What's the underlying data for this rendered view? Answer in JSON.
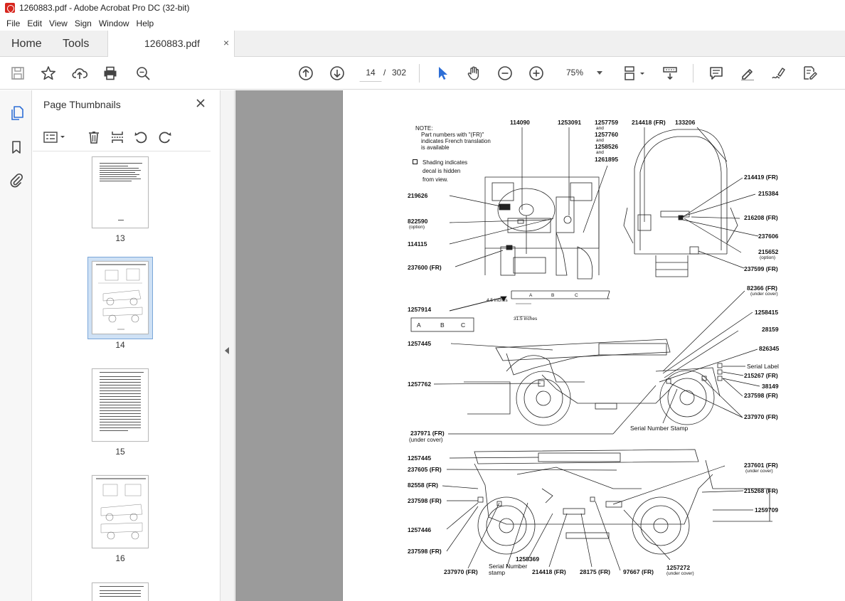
{
  "window": {
    "title": "1260883.pdf - Adobe Acrobat Pro DC (32-bit)"
  },
  "menu": [
    "File",
    "Edit",
    "View",
    "Sign",
    "Window",
    "Help"
  ],
  "tabs": {
    "home": "Home",
    "tools": "Tools",
    "document": "1260883.pdf",
    "close": "×"
  },
  "toolbar": {
    "current_page": "14",
    "page_separator": "/",
    "total_pages": "302",
    "zoom": "75%"
  },
  "thumbnails": {
    "title": "Page Thumbnails",
    "close": "✕",
    "pages": [
      {
        "label": "13"
      },
      {
        "label": "14",
        "selected": true
      },
      {
        "label": "15"
      },
      {
        "label": "16"
      }
    ]
  },
  "document": {
    "note": {
      "heading": "NOTE:",
      "line1": "Part numbers with \"(FR)\"",
      "line2": "indicates French translation",
      "line3": "is available",
      "shade1": "Shading indicates",
      "shade2": "decal is hidden",
      "shade3": "from view."
    },
    "top_labels": {
      "p114090": "114090",
      "p1253091": "1253091",
      "p1257759": "1257759",
      "and1": "and",
      "p1257760": "1257760",
      "and2": "and",
      "p1258526": "1258526",
      "and3": "and",
      "p1261895": "1261895",
      "p214418": "214418 (FR)",
      "p133206": "133206"
    },
    "cab_left": {
      "p219626": "219626",
      "p822590": "822590",
      "option1": "(option)",
      "p114115": "114115",
      "p237600": "237600 (FR)"
    },
    "cab_right": {
      "p214419": "214419 (FR)",
      "p215384": "215384",
      "p216208": "216208 (FR)",
      "p237606": "237606",
      "p215652": "215652",
      "option2": "(option)",
      "p237599": "237599 (FR)"
    },
    "strip": {
      "p1257914": "1257914",
      "inches1": "4.5 inches",
      "inches2": "31.5 inches",
      "a": "A",
      "b": "B",
      "c": "C",
      "box_a": "A",
      "box_b": "B",
      "box_c": "C"
    },
    "side1": {
      "p82366": "82366 (FR)",
      "under1": "(under cover)",
      "p1258415": "1258415",
      "p28159": "28159",
      "p826345": "826345",
      "serial_label": "Serial Label",
      "p215267": "215267 (FR)",
      "p38149": "38149",
      "p237598a": "237598 (FR)",
      "p237970a": "237970 (FR)",
      "serial_stamp": "Serial Number Stamp",
      "p1257445a": "1257445",
      "p1257762": "1257762",
      "p237971": "237971 (FR)",
      "under2": "(under cover)"
    },
    "side2": {
      "p1257445b": "1257445",
      "p237605": "237605 (FR)",
      "p82558": "82558 (FR)",
      "p237598b": "237598 (FR)",
      "p1257446": "1257446",
      "p237598c": "237598 (FR)",
      "p237970b": "237970 (FR)",
      "serial_num": "Serial Number",
      "stamp": "stamp",
      "p1258369": "1258369",
      "p214418b": "214418 (FR)",
      "p28175": "28175 (FR)",
      "p97667": "97667 (FR)",
      "p1257272": "1257272",
      "under3": "(under cover)",
      "p237601": "237601 (FR)",
      "under4": "(under cover)",
      "p215268": "215268 (FR)",
      "p1259709": "1259709"
    }
  }
}
